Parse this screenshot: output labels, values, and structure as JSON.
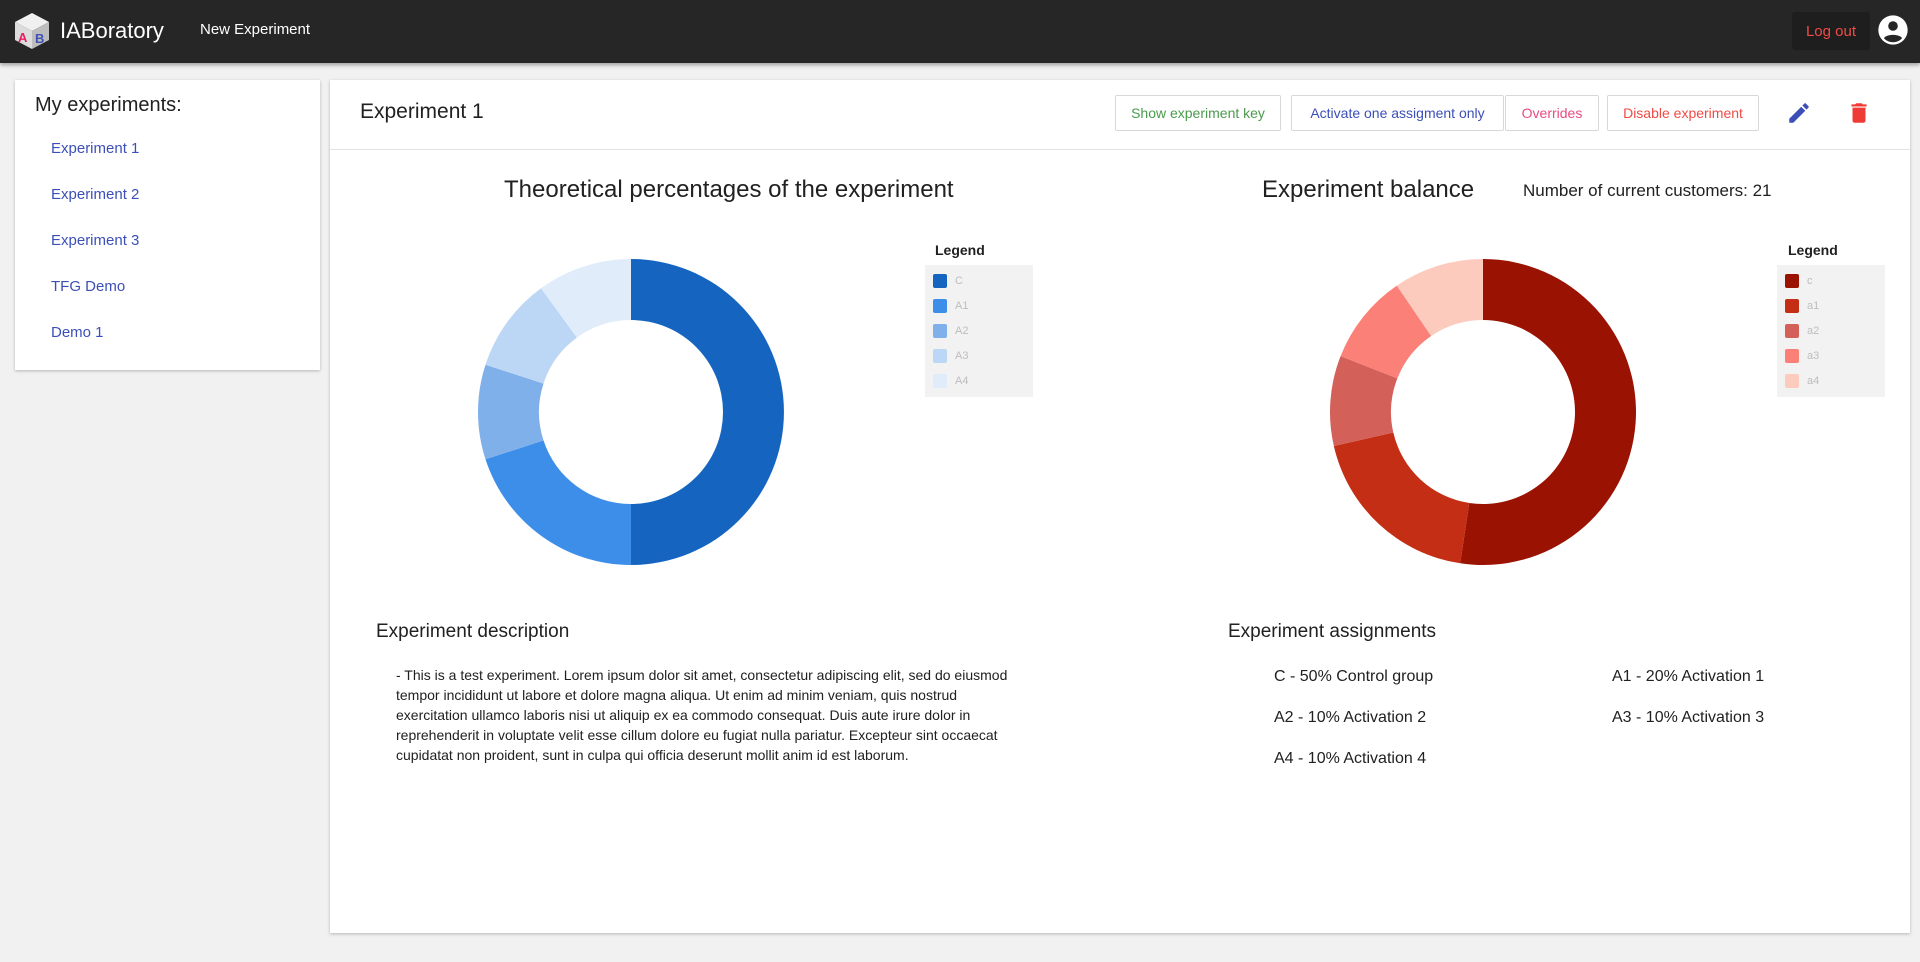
{
  "app": {
    "title": "IABoratory",
    "new_experiment": "New Experiment",
    "logout": "Log out"
  },
  "sidebar": {
    "title": "My experiments:",
    "items": [
      {
        "label": "Experiment 1"
      },
      {
        "label": "Experiment 2"
      },
      {
        "label": "Experiment 3"
      },
      {
        "label": "TFG Demo"
      },
      {
        "label": "Demo 1"
      }
    ]
  },
  "experiment": {
    "title": "Experiment 1",
    "buttons": {
      "show_key": "Show experiment key",
      "activate_one": "Activate one assigment only",
      "overrides": "Overrides",
      "disable": "Disable experiment"
    },
    "theoretical_title": "Theoretical percentages of the experiment",
    "balance_title": "Experiment balance",
    "customers": "Number of current customers: 21",
    "legend_title": "Legend",
    "description_title": "Experiment description",
    "description": "- This is a test experiment. Lorem ipsum dolor sit amet, consectetur adipiscing elit, sed do eiusmod tempor incididunt ut labore et dolore magna aliqua. Ut enim ad minim veniam, quis nostrud exercitation ullamco laboris nisi ut aliquip ex ea commodo consequat. Duis aute irure dolor in reprehenderit in voluptate velit esse cillum dolore eu fugiat nulla pariatur. Excepteur sint occaecat cupidatat non proident, sunt in culpa qui officia deserunt mollit anim id est laborum.",
    "assignments_title": "Experiment assignments",
    "assignments": [
      {
        "text": "C - 50% Control group"
      },
      {
        "text": "A1 - 20% Activation 1"
      },
      {
        "text": "A2 - 10% Activation 2"
      },
      {
        "text": "A3 - 10% Activation 3"
      },
      {
        "text": "A4 - 10% Activation 4"
      }
    ]
  },
  "chart_data": [
    {
      "type": "pie",
      "title": "Theoretical percentages of the experiment",
      "legend_title": "Legend",
      "legend_position": "right",
      "categories": [
        "C",
        "A1",
        "A2",
        "A3",
        "A4"
      ],
      "values": [
        50,
        20,
        10,
        10,
        10
      ],
      "colors": [
        "#1565c0",
        "#3d8ee8",
        "#7fb0ea",
        "#bcd6f5",
        "#e1ecfa"
      ]
    },
    {
      "type": "pie",
      "title": "Experiment balance",
      "legend_title": "Legend",
      "legend_position": "right",
      "categories": [
        "c",
        "a1",
        "a2",
        "a3",
        "a4"
      ],
      "values": [
        11,
        4,
        2,
        2,
        2
      ],
      "colors": [
        "#9a1202",
        "#c42e14",
        "#d4605a",
        "#fa8078",
        "#fdcbbd"
      ]
    }
  ]
}
